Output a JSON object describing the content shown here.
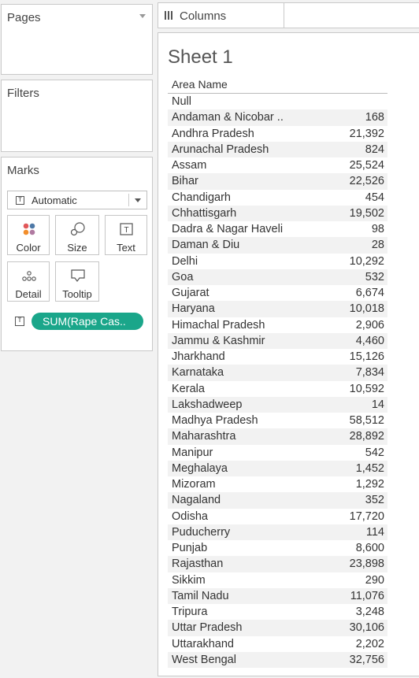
{
  "pages": {
    "title": "Pages"
  },
  "filters": {
    "title": "Filters"
  },
  "marks": {
    "title": "Marks",
    "mark_type": "Automatic",
    "buttons": {
      "color": "Color",
      "size": "Size",
      "text": "Text",
      "detail": "Detail",
      "tooltip": "Tooltip"
    },
    "pill": "SUM(Rape Cas..",
    "pill_color": "#1aa68a"
  },
  "columns": {
    "label": "Columns"
  },
  "sheet": {
    "title": "Sheet 1",
    "column_header": "Area Name",
    "rows": [
      {
        "name": "Null",
        "value": ""
      },
      {
        "name": "Andaman & Nicobar ..",
        "value": "168"
      },
      {
        "name": "Andhra Pradesh",
        "value": "21,392"
      },
      {
        "name": "Arunachal Pradesh",
        "value": "824"
      },
      {
        "name": "Assam",
        "value": "25,524"
      },
      {
        "name": "Bihar",
        "value": "22,526"
      },
      {
        "name": "Chandigarh",
        "value": "454"
      },
      {
        "name": "Chhattisgarh",
        "value": "19,502"
      },
      {
        "name": "Dadra & Nagar Haveli",
        "value": "98"
      },
      {
        "name": "Daman & Diu",
        "value": "28"
      },
      {
        "name": "Delhi",
        "value": "10,292"
      },
      {
        "name": "Goa",
        "value": "532"
      },
      {
        "name": "Gujarat",
        "value": "6,674"
      },
      {
        "name": "Haryana",
        "value": "10,018"
      },
      {
        "name": "Himachal Pradesh",
        "value": "2,906"
      },
      {
        "name": "Jammu & Kashmir",
        "value": "4,460"
      },
      {
        "name": "Jharkhand",
        "value": "15,126"
      },
      {
        "name": "Karnataka",
        "value": "7,834"
      },
      {
        "name": "Kerala",
        "value": "10,592"
      },
      {
        "name": "Lakshadweep",
        "value": "14"
      },
      {
        "name": "Madhya Pradesh",
        "value": "58,512"
      },
      {
        "name": "Maharashtra",
        "value": "28,892"
      },
      {
        "name": "Manipur",
        "value": "542"
      },
      {
        "name": "Meghalaya",
        "value": "1,452"
      },
      {
        "name": "Mizoram",
        "value": "1,292"
      },
      {
        "name": "Nagaland",
        "value": "352"
      },
      {
        "name": "Odisha",
        "value": "17,720"
      },
      {
        "name": "Puducherry",
        "value": "114"
      },
      {
        "name": "Punjab",
        "value": "8,600"
      },
      {
        "name": "Rajasthan",
        "value": "23,898"
      },
      {
        "name": "Sikkim",
        "value": "290"
      },
      {
        "name": "Tamil Nadu",
        "value": "11,076"
      },
      {
        "name": "Tripura",
        "value": "3,248"
      },
      {
        "name": "Uttar Pradesh",
        "value": "30,106"
      },
      {
        "name": "Uttarakhand",
        "value": "2,202"
      },
      {
        "name": "West Bengal",
        "value": "32,756"
      }
    ]
  }
}
